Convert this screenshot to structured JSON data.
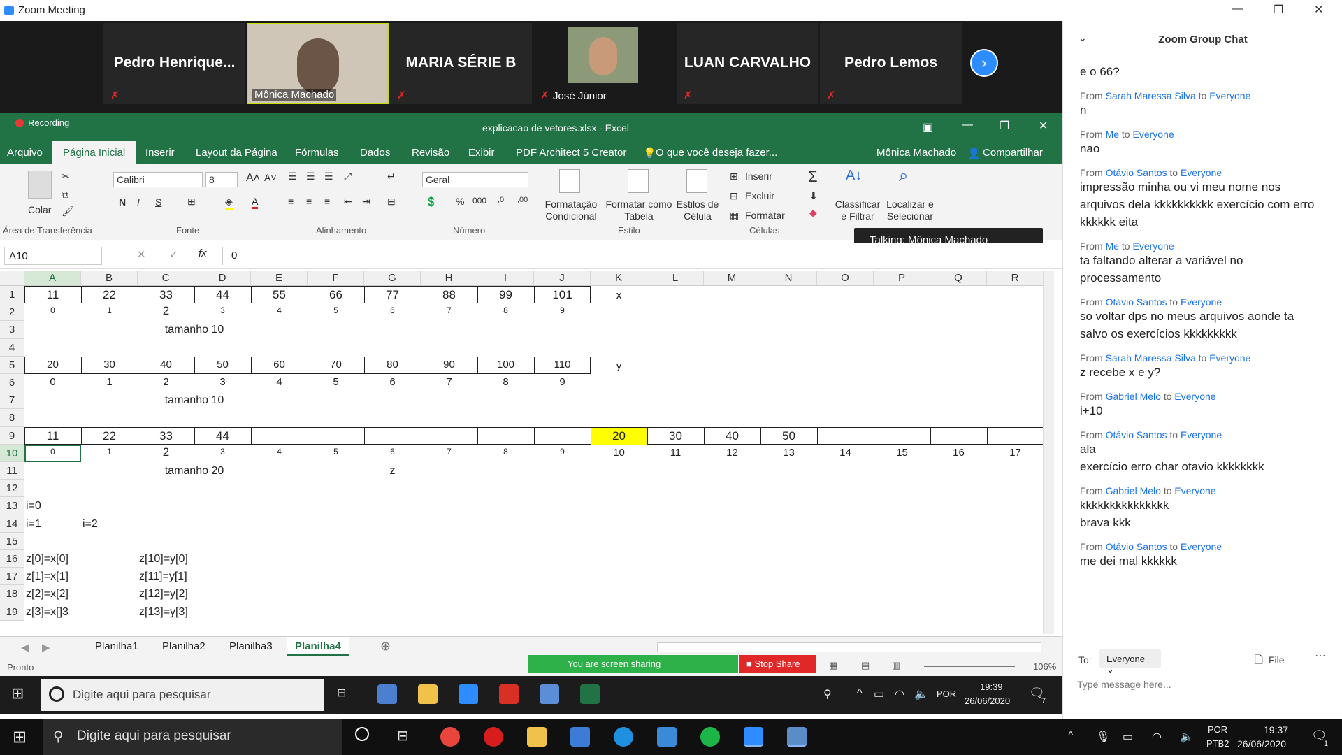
{
  "zoom": {
    "title": "Zoom Meeting"
  },
  "participants": [
    {
      "name": "Pedro  Henrique..."
    },
    {
      "name": "Mônica Machado"
    },
    {
      "name": "MARIA SÉRIE B"
    },
    {
      "name": "José Júnior"
    },
    {
      "name": "LUAN CARVALHO"
    },
    {
      "name": "Pedro Lemos"
    }
  ],
  "excel": {
    "recording": "Recording",
    "title": "explicacao de vetores.xlsx - Excel",
    "menu": [
      "Arquivo",
      "Página Inicial",
      "Inserir",
      "Layout da Página",
      "Fórmulas",
      "Dados",
      "Revisão",
      "Exibir",
      "PDF Architect 5 Creator",
      "O que você deseja fazer...",
      "Mônica Machado",
      "Compartilhar"
    ],
    "ribbon": {
      "paste": "Colar",
      "font_name": "Calibri",
      "font_size": "8",
      "bold": "N",
      "italic": "I",
      "underline": "S",
      "number_format": "Geral",
      "percent": "%",
      "thousands": "000",
      "cond_format": "Formatação\nCondicional",
      "format_table": "Formatar como\nTabela",
      "cell_styles": "Estilos de\nCélula",
      "insert": "Inserir",
      "delete": "Excluir",
      "format": "Formatar",
      "sort": "Classificar\ne Filtrar",
      "find": "Localizar e\nSelecionar",
      "groups": [
        "Área de Transferência",
        "Fonte",
        "Alinhamento",
        "Número",
        "Estilo",
        "Células"
      ]
    },
    "talking": "Talking: Mônica Machado",
    "name_box": "A10",
    "formula": "0",
    "fx": "fx",
    "columns": [
      "A",
      "B",
      "C",
      "D",
      "E",
      "F",
      "G",
      "H",
      "I",
      "J",
      "K",
      "L",
      "M",
      "N",
      "O",
      "P",
      "Q",
      "R"
    ],
    "rows": [
      "1",
      "2",
      "3",
      "4",
      "5",
      "6",
      "7",
      "8",
      "9",
      "10",
      "11",
      "12",
      "13",
      "14",
      "15",
      "16",
      "17",
      "18",
      "19"
    ],
    "row1": [
      "11",
      "22",
      "33",
      "44",
      "55",
      "66",
      "77",
      "88",
      "99",
      "101"
    ],
    "row1_label": "x",
    "row2": [
      "0",
      "1",
      "2",
      "3",
      "4",
      "5",
      "6",
      "7",
      "8",
      "9"
    ],
    "row3": "tamanho 10",
    "row5": [
      "20",
      "30",
      "40",
      "50",
      "60",
      "70",
      "80",
      "90",
      "100",
      "110"
    ],
    "row5_label": "y",
    "row6": [
      "0",
      "1",
      "2",
      "3",
      "4",
      "5",
      "6",
      "7",
      "8",
      "9"
    ],
    "row7": "tamanho 10",
    "row9": [
      "11",
      "22",
      "33",
      "44",
      "",
      "",
      "",
      "",
      "",
      "",
      "20",
      "30",
      "40",
      "50",
      "",
      "",
      "",
      ""
    ],
    "row10": [
      "0",
      "1",
      "2",
      "3",
      "4",
      "5",
      "6",
      "7",
      "8",
      "9",
      "10",
      "11",
      "12",
      "13",
      "14",
      "15",
      "16",
      "17"
    ],
    "row11": "tamanho 20",
    "row11_z": "z",
    "row13": "i=0",
    "row14a": "i=1",
    "row14b": "i=2",
    "row16": [
      "z[0]=x[0]",
      "z[10]=y[0]"
    ],
    "row17": [
      "z[1]=x[1]",
      "z[11]=y[1]"
    ],
    "row18": [
      "z[2]=x[2]",
      "z[12]=y[2]"
    ],
    "row19": [
      "z[3]=x[]3",
      "z[13]=y[3]"
    ],
    "sheets": [
      "Planilha1",
      "Planilha2",
      "Planilha3",
      "Planilha4"
    ],
    "status": "Pronto",
    "sharing": "You are screen sharing",
    "stop_share": "Stop Share",
    "zoom_level": "106%",
    "highlight": "#ffff00"
  },
  "chat": {
    "title": "Zoom Group Chat",
    "first": "e o 66?",
    "messages": [
      {
        "from": "Sarah Maressa Silva",
        "to": "Everyone",
        "text": "n"
      },
      {
        "from": "Me",
        "to": "Everyone",
        "text": "nao"
      },
      {
        "from": "Otávio Santos",
        "to": "Everyone",
        "text": "impressão minha ou vi meu nome nos arquivos dela kkkkkkkkkk exercício com erro kkkkkk eita"
      },
      {
        "from": "Me",
        "to": "Everyone",
        "text": "ta faltando alterar a variável no processamento"
      },
      {
        "from": "Otávio Santos",
        "to": "Everyone",
        "text": "so voltar dps no meus arquivos aonde ta salvo os exercícios kkkkkkkkk"
      },
      {
        "from": "Sarah Maressa Silva",
        "to": "Everyone",
        "text": "z recebe x e y?"
      },
      {
        "from": "Gabriel Melo",
        "to": "Everyone",
        "text": "i+10"
      },
      {
        "from": "Otávio Santos",
        "to": "Everyone",
        "text": "ala\nexercício erro char otavio kkkkkkkk"
      },
      {
        "from": "Gabriel Melo",
        "to": "Everyone",
        "text": "kkkkkkkkkkkkkkk\nbrava kkk"
      },
      {
        "from": "Otávio Santos",
        "to": "Everyone",
        "text": "me dei mal kkkkkk"
      }
    ],
    "from_word": "From",
    "to_word": "to",
    "to_label": "To:",
    "to_value": "Everyone",
    "file": "File",
    "placeholder": "Type message here..."
  },
  "taskbar1": {
    "search": "Digite aqui para pesquisar",
    "lang": "POR",
    "time": "19:39",
    "date": "26/06/2020",
    "badge": "7"
  },
  "taskbar2": {
    "search": "Digite aqui para pesquisar",
    "lang": "POR",
    "lang2": "PTB2",
    "time": "19:37",
    "date": "26/06/2020",
    "badge": "1"
  }
}
